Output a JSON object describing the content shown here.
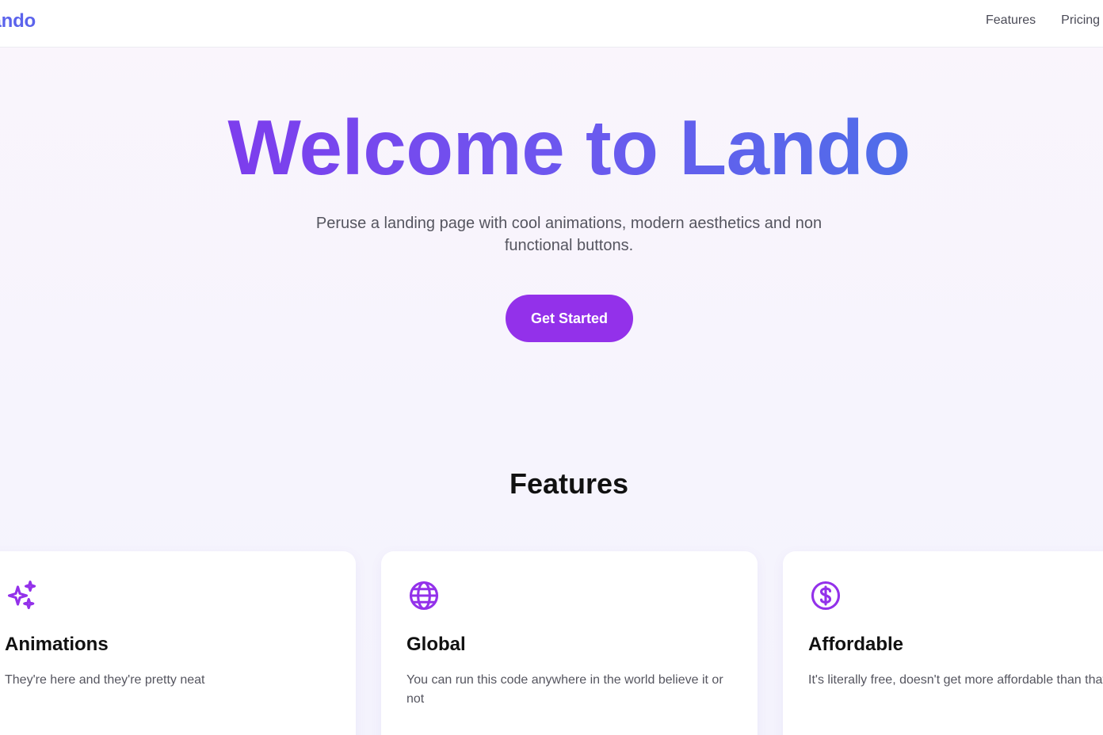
{
  "nav": {
    "logo": "Lando",
    "links": [
      "Features",
      "Pricing"
    ]
  },
  "hero": {
    "title": "Welcome to Lando",
    "subtitle": "Peruse a landing page with cool animations, modern aesthetics and non functional buttons.",
    "cta_label": "Get Started"
  },
  "features": {
    "heading": "Features",
    "cards": [
      {
        "icon": "sparkles-icon",
        "title": "Animations",
        "description": "They're here and they're pretty neat"
      },
      {
        "icon": "globe-icon",
        "title": "Global",
        "description": "You can run this code anywhere in the world believe it or not"
      },
      {
        "icon": "dollar-circle-icon",
        "title": "Affordable",
        "description": "It's literally free, doesn't get more affordable than that"
      }
    ]
  },
  "colors": {
    "accent": "#9331ea",
    "logo": "#5b63ec",
    "gradient_start": "#7d3ded",
    "gradient_end": "#4f6ee9"
  }
}
